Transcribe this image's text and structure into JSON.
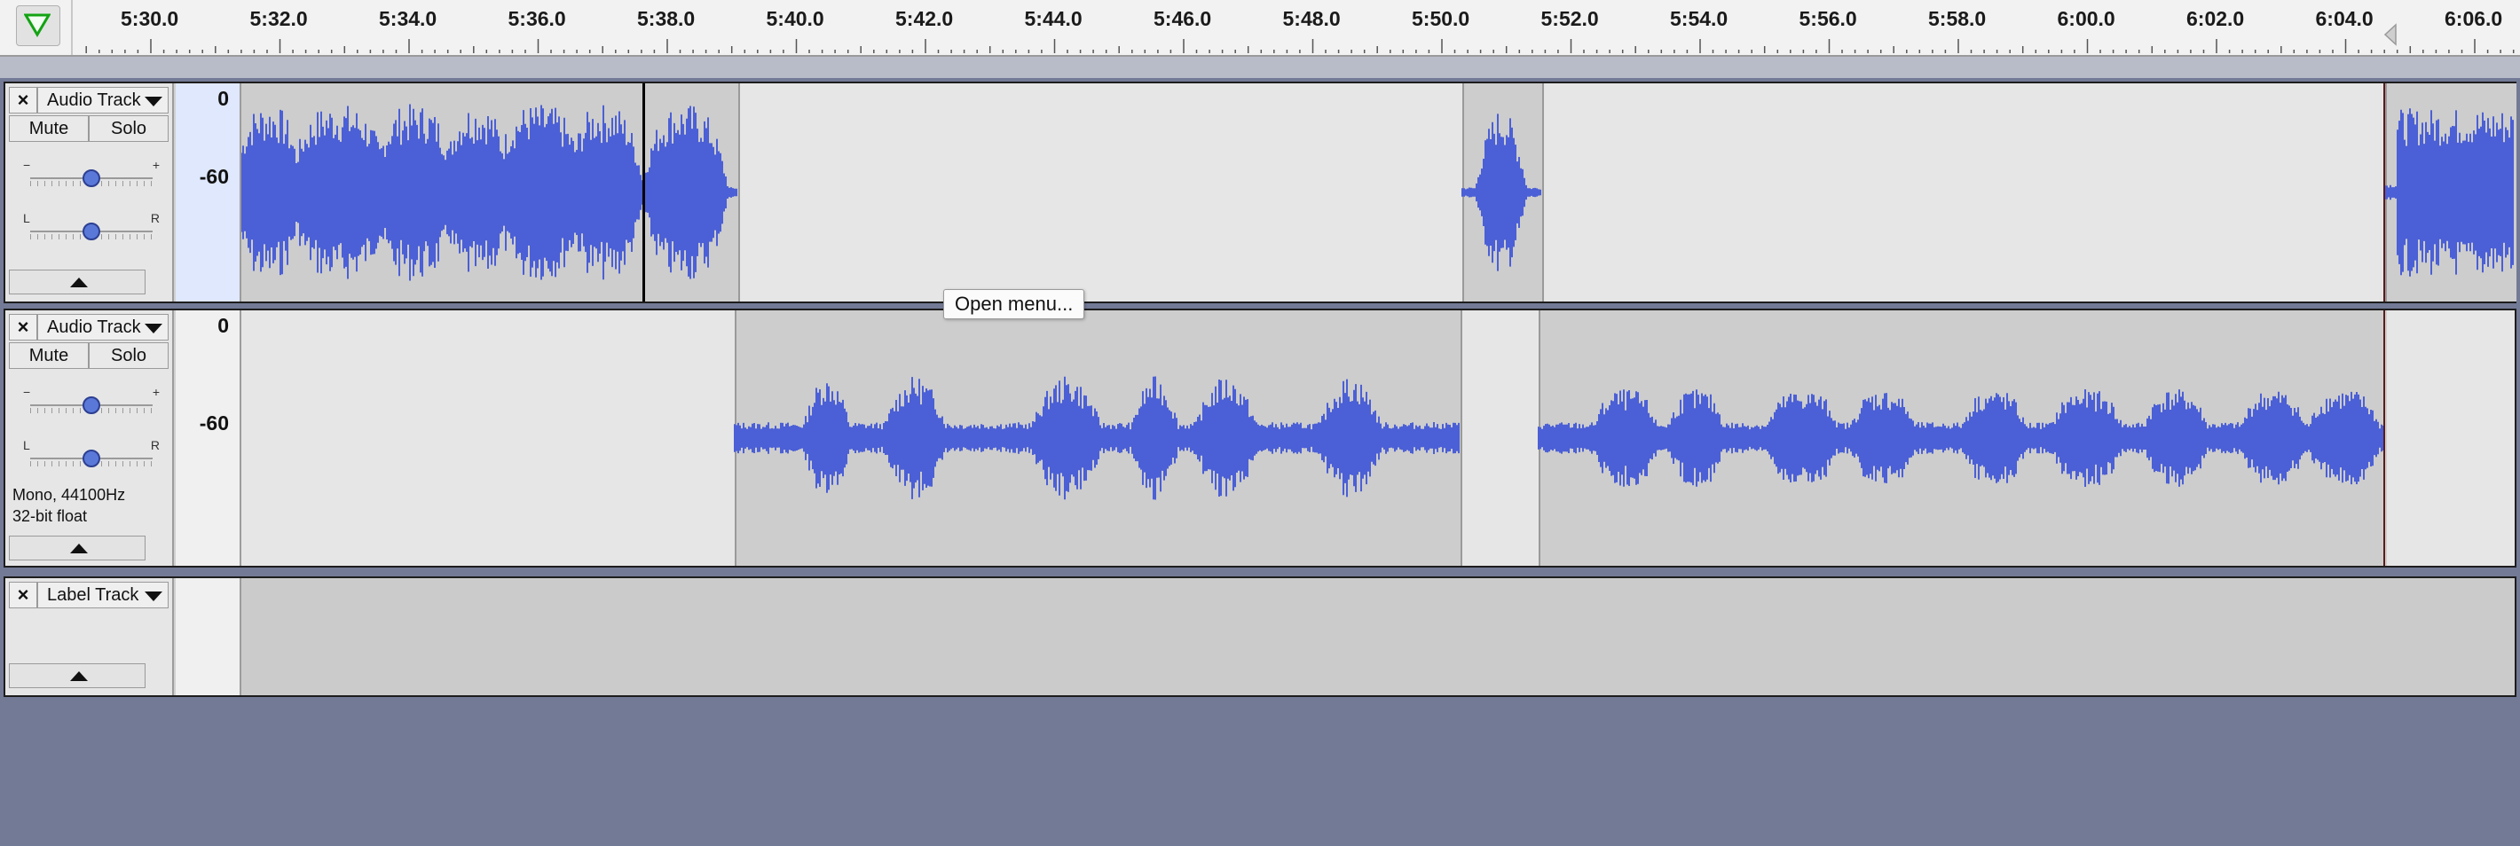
{
  "ruler": {
    "play_indicator_icon": "green-down-triangle-icon",
    "time_labels": [
      "5:30.0",
      "5:32.0",
      "5:34.0",
      "5:36.0",
      "5:38.0",
      "5:40.0",
      "5:42.0",
      "5:44.0",
      "5:46.0",
      "5:48.0",
      "5:50.0",
      "5:52.0",
      "5:54.0",
      "5:56.0",
      "5:58.0",
      "6:00.0",
      "6:02.0",
      "6:04.0",
      "6:06.0"
    ]
  },
  "tracks": [
    {
      "name": "Audio Track",
      "close_label": "×",
      "mute_label": "Mute",
      "solo_label": "Solo",
      "gain_min": "−",
      "gain_max": "+",
      "pan_left": "L",
      "pan_right": "R",
      "db_top": "0",
      "db_mid": "-60",
      "selected": true
    },
    {
      "name": "Audio Track",
      "close_label": "×",
      "mute_label": "Mute",
      "solo_label": "Solo",
      "gain_min": "−",
      "gain_max": "+",
      "pan_left": "L",
      "pan_right": "R",
      "db_top": "0",
      "db_mid": "-60",
      "format_line1": "Mono, 44100Hz",
      "format_line2": "32-bit float",
      "selected": false
    },
    {
      "name": "Label Track",
      "close_label": "×"
    }
  ],
  "tooltip": {
    "text": "Open menu..."
  },
  "colors": {
    "waveform": "#4b5fd6",
    "waveform_fill": "#6f82e6",
    "background": "#737a96",
    "selected_ruler": "#dfe8fc"
  }
}
